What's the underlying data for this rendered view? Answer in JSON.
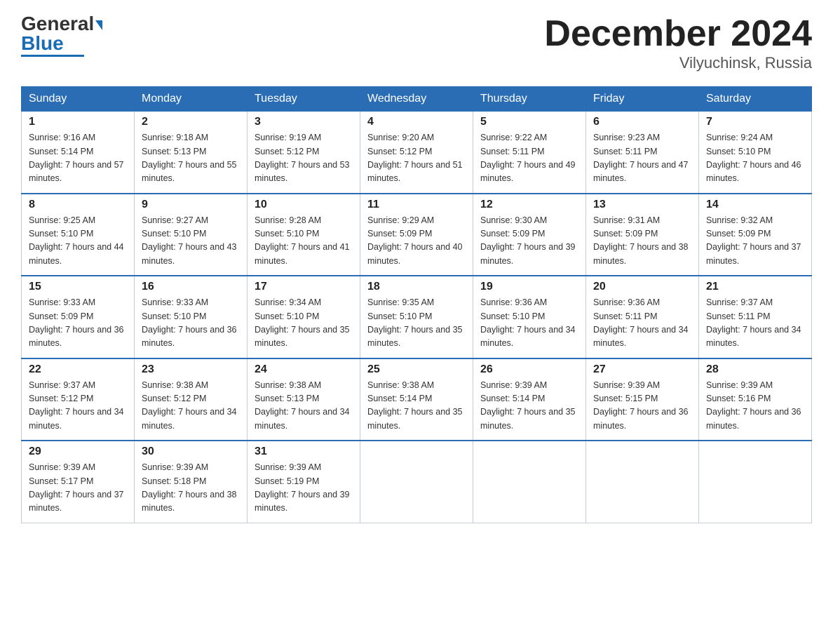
{
  "header": {
    "logo_main": "General",
    "logo_blue": "Blue",
    "title": "December 2024",
    "subtitle": "Vilyuchinsk, Russia"
  },
  "weekdays": [
    "Sunday",
    "Monday",
    "Tuesday",
    "Wednesday",
    "Thursday",
    "Friday",
    "Saturday"
  ],
  "weeks": [
    [
      {
        "day": "1",
        "sunrise": "9:16 AM",
        "sunset": "5:14 PM",
        "daylight": "7 hours and 57 minutes."
      },
      {
        "day": "2",
        "sunrise": "9:18 AM",
        "sunset": "5:13 PM",
        "daylight": "7 hours and 55 minutes."
      },
      {
        "day": "3",
        "sunrise": "9:19 AM",
        "sunset": "5:12 PM",
        "daylight": "7 hours and 53 minutes."
      },
      {
        "day": "4",
        "sunrise": "9:20 AM",
        "sunset": "5:12 PM",
        "daylight": "7 hours and 51 minutes."
      },
      {
        "day": "5",
        "sunrise": "9:22 AM",
        "sunset": "5:11 PM",
        "daylight": "7 hours and 49 minutes."
      },
      {
        "day": "6",
        "sunrise": "9:23 AM",
        "sunset": "5:11 PM",
        "daylight": "7 hours and 47 minutes."
      },
      {
        "day": "7",
        "sunrise": "9:24 AM",
        "sunset": "5:10 PM",
        "daylight": "7 hours and 46 minutes."
      }
    ],
    [
      {
        "day": "8",
        "sunrise": "9:25 AM",
        "sunset": "5:10 PM",
        "daylight": "7 hours and 44 minutes."
      },
      {
        "day": "9",
        "sunrise": "9:27 AM",
        "sunset": "5:10 PM",
        "daylight": "7 hours and 43 minutes."
      },
      {
        "day": "10",
        "sunrise": "9:28 AM",
        "sunset": "5:10 PM",
        "daylight": "7 hours and 41 minutes."
      },
      {
        "day": "11",
        "sunrise": "9:29 AM",
        "sunset": "5:09 PM",
        "daylight": "7 hours and 40 minutes."
      },
      {
        "day": "12",
        "sunrise": "9:30 AM",
        "sunset": "5:09 PM",
        "daylight": "7 hours and 39 minutes."
      },
      {
        "day": "13",
        "sunrise": "9:31 AM",
        "sunset": "5:09 PM",
        "daylight": "7 hours and 38 minutes."
      },
      {
        "day": "14",
        "sunrise": "9:32 AM",
        "sunset": "5:09 PM",
        "daylight": "7 hours and 37 minutes."
      }
    ],
    [
      {
        "day": "15",
        "sunrise": "9:33 AM",
        "sunset": "5:09 PM",
        "daylight": "7 hours and 36 minutes."
      },
      {
        "day": "16",
        "sunrise": "9:33 AM",
        "sunset": "5:10 PM",
        "daylight": "7 hours and 36 minutes."
      },
      {
        "day": "17",
        "sunrise": "9:34 AM",
        "sunset": "5:10 PM",
        "daylight": "7 hours and 35 minutes."
      },
      {
        "day": "18",
        "sunrise": "9:35 AM",
        "sunset": "5:10 PM",
        "daylight": "7 hours and 35 minutes."
      },
      {
        "day": "19",
        "sunrise": "9:36 AM",
        "sunset": "5:10 PM",
        "daylight": "7 hours and 34 minutes."
      },
      {
        "day": "20",
        "sunrise": "9:36 AM",
        "sunset": "5:11 PM",
        "daylight": "7 hours and 34 minutes."
      },
      {
        "day": "21",
        "sunrise": "9:37 AM",
        "sunset": "5:11 PM",
        "daylight": "7 hours and 34 minutes."
      }
    ],
    [
      {
        "day": "22",
        "sunrise": "9:37 AM",
        "sunset": "5:12 PM",
        "daylight": "7 hours and 34 minutes."
      },
      {
        "day": "23",
        "sunrise": "9:38 AM",
        "sunset": "5:12 PM",
        "daylight": "7 hours and 34 minutes."
      },
      {
        "day": "24",
        "sunrise": "9:38 AM",
        "sunset": "5:13 PM",
        "daylight": "7 hours and 34 minutes."
      },
      {
        "day": "25",
        "sunrise": "9:38 AM",
        "sunset": "5:14 PM",
        "daylight": "7 hours and 35 minutes."
      },
      {
        "day": "26",
        "sunrise": "9:39 AM",
        "sunset": "5:14 PM",
        "daylight": "7 hours and 35 minutes."
      },
      {
        "day": "27",
        "sunrise": "9:39 AM",
        "sunset": "5:15 PM",
        "daylight": "7 hours and 36 minutes."
      },
      {
        "day": "28",
        "sunrise": "9:39 AM",
        "sunset": "5:16 PM",
        "daylight": "7 hours and 36 minutes."
      }
    ],
    [
      {
        "day": "29",
        "sunrise": "9:39 AM",
        "sunset": "5:17 PM",
        "daylight": "7 hours and 37 minutes."
      },
      {
        "day": "30",
        "sunrise": "9:39 AM",
        "sunset": "5:18 PM",
        "daylight": "7 hours and 38 minutes."
      },
      {
        "day": "31",
        "sunrise": "9:39 AM",
        "sunset": "5:19 PM",
        "daylight": "7 hours and 39 minutes."
      },
      null,
      null,
      null,
      null
    ]
  ]
}
